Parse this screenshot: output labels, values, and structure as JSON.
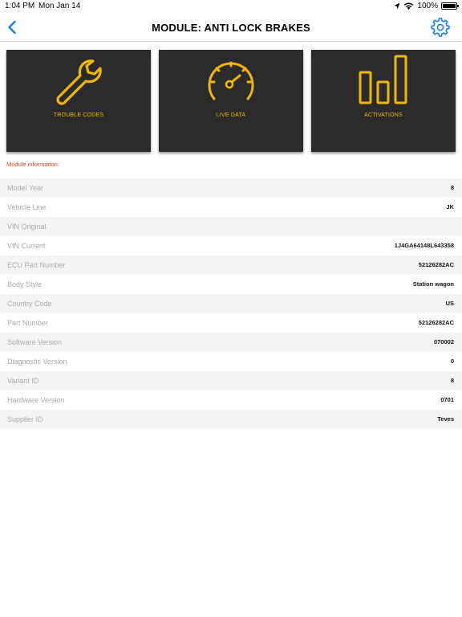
{
  "status": {
    "time": "1:04 PM",
    "date": "Mon Jan 14",
    "battery": "100%",
    "battery_level": 1.0
  },
  "nav": {
    "title": "MODULE: ANTI LOCK BRAKES",
    "back_icon": "chevron-left-icon",
    "settings_icon": "gear-icon"
  },
  "colors": {
    "accent": "#F2B705",
    "tile_bg": "#2B2B2B",
    "nav_blue": "#1A7CF5",
    "info_label_red": "#E2421A"
  },
  "tiles": [
    {
      "label": "TROUBLE CODES",
      "icon": "wrench-icon"
    },
    {
      "label": "LIVE DATA",
      "icon": "speedometer-icon"
    },
    {
      "label": "ACTIVATIONS",
      "icon": "bar-chart-icon"
    }
  ],
  "section_title": "Module information:",
  "rows": [
    {
      "label": "Model Year",
      "value": "8"
    },
    {
      "label": "Vehicle Line",
      "value": "JK"
    },
    {
      "label": "VIN Original",
      "value": ""
    },
    {
      "label": "VIN Current",
      "value": "1J4GA64148L643358"
    },
    {
      "label": "ECU Part Number",
      "value": "52126282AC"
    },
    {
      "label": "Body Style",
      "value": "Station wagon"
    },
    {
      "label": "Country Code",
      "value": "US"
    },
    {
      "label": "Part Number",
      "value": "52126282AC"
    },
    {
      "label": "Software Version",
      "value": "070002"
    },
    {
      "label": "Diagnostic Version",
      "value": "0"
    },
    {
      "label": "Variant ID",
      "value": "8"
    },
    {
      "label": "Hardware Version",
      "value": "0701"
    },
    {
      "label": "Supplier ID",
      "value": "Teves"
    }
  ]
}
